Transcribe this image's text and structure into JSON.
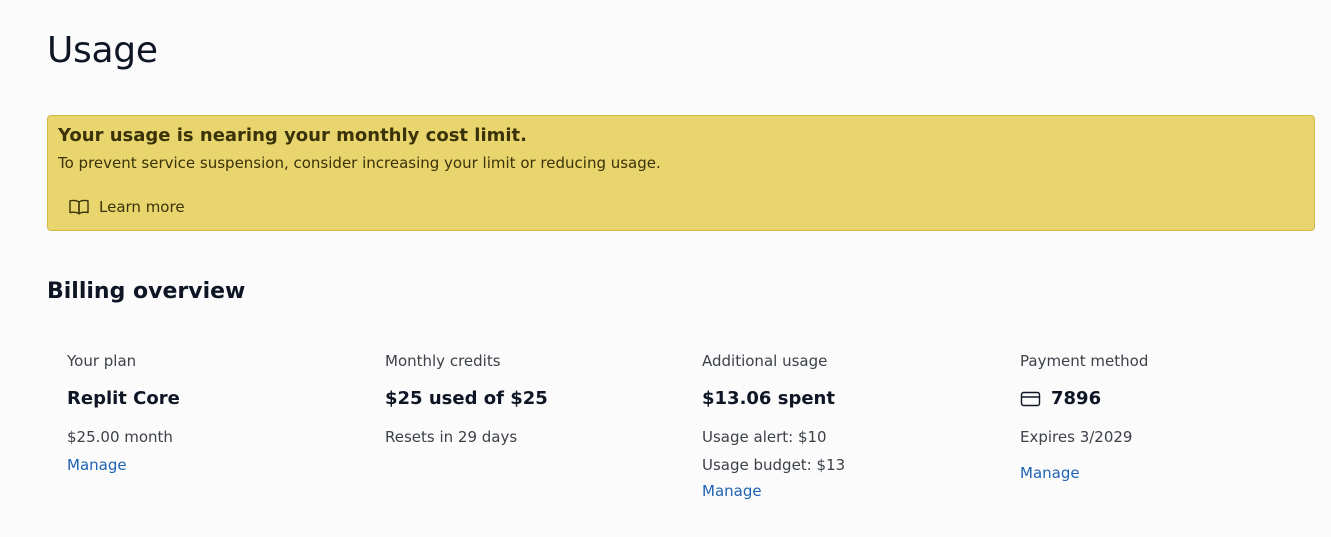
{
  "page": {
    "title": "Usage"
  },
  "alert": {
    "title": "Your usage is nearing your monthly cost limit.",
    "body": "To prevent service suspension, consider increasing your limit or reducing usage.",
    "learn_more_label": "Learn more",
    "learn_more_icon": "book-icon",
    "background_color": "#e9d56e"
  },
  "billing": {
    "title": "Billing overview",
    "plan": {
      "label": "Your plan",
      "value": "Replit Core",
      "price": "$25.00 month",
      "manage_label": "Manage"
    },
    "credits": {
      "label": "Monthly credits",
      "value": "$25 used of $25",
      "resets": "Resets in 29 days"
    },
    "additional": {
      "label": "Additional usage",
      "value": "$13.06 spent",
      "alert": "Usage alert: $10",
      "budget": "Usage budget: $13",
      "manage_label": "Manage"
    },
    "payment": {
      "label": "Payment method",
      "card_icon": "credit-card-icon",
      "card_last4": "7896",
      "expires": "Expires 3/2029",
      "manage_label": "Manage"
    }
  },
  "colors": {
    "link": "#1e63b5",
    "page_background": "#fbfbfc"
  }
}
